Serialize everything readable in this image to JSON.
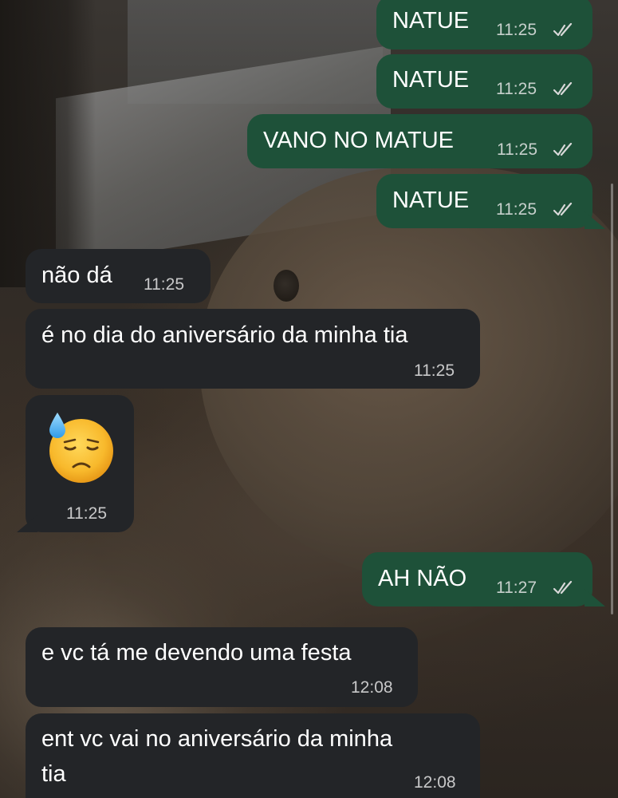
{
  "messages": [
    {
      "direction": "outgoing",
      "text": "NATUE",
      "time": "11:25",
      "status_icon": "double-check-icon"
    },
    {
      "direction": "outgoing",
      "text": "NATUE",
      "time": "11:25",
      "status_icon": "double-check-icon"
    },
    {
      "direction": "outgoing",
      "text": "VANO NO MATUE",
      "time": "11:25",
      "status_icon": "double-check-icon"
    },
    {
      "direction": "outgoing",
      "text": "NATUE",
      "time": "11:25",
      "status_icon": "double-check-icon"
    },
    {
      "direction": "incoming",
      "text": "não dá",
      "time": "11:25"
    },
    {
      "direction": "incoming",
      "text": "é no dia do aniversário da minha tia",
      "time": "11:25"
    },
    {
      "direction": "incoming",
      "emoji": "downcast-face-with-sweat-icon",
      "time": "11:25"
    },
    {
      "direction": "outgoing",
      "text": "AH NÃO",
      "time": "11:27",
      "status_icon": "double-check-icon"
    },
    {
      "direction": "incoming",
      "text": "e vc tá me devendo uma festa",
      "time": "12:08"
    },
    {
      "direction": "incoming",
      "text_lines": [
        "ent vc vai no aniversário da minha",
        "tia"
      ],
      "time": "12:08"
    }
  ],
  "colors": {
    "outgoing_bubble": "#1e5139",
    "incoming_bubble": "#232528",
    "text": "#ffffff",
    "timestamp": "#ebebeb",
    "ticks": "#d8d8d8"
  }
}
